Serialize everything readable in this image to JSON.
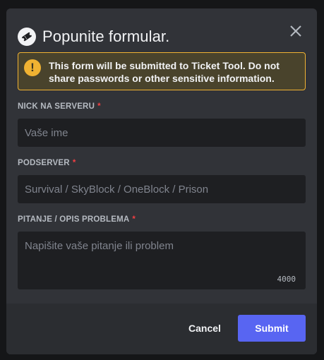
{
  "modal": {
    "title": "Popunite formular.",
    "app_icon": "ticket-icon",
    "close_icon": "close-icon"
  },
  "warning": {
    "icon": "warning-icon",
    "icon_glyph": "!",
    "text_prefix": "This form will be submitted to ",
    "app_name": "Ticket Tool",
    "text_suffix": ". Do not share passwords or other sensitive information."
  },
  "fields": [
    {
      "label": "NICK NA SERVERU",
      "required_mark": "*",
      "placeholder": "Vaše ime",
      "value": ""
    },
    {
      "label": "PODSERVER",
      "required_mark": "*",
      "placeholder": "Survival / SkyBlock / OneBlock / Prison",
      "value": ""
    },
    {
      "label": "PITANJE / OPIS PROBLEMA",
      "required_mark": "*",
      "placeholder": "Napišite vaše pitanje ili problem",
      "value": "",
      "char_limit": "4000"
    }
  ],
  "footer": {
    "cancel_label": "Cancel",
    "submit_label": "Submit"
  },
  "colors": {
    "accent": "#5865f2",
    "warning_border": "#f0b232",
    "required": "#f23f43"
  }
}
